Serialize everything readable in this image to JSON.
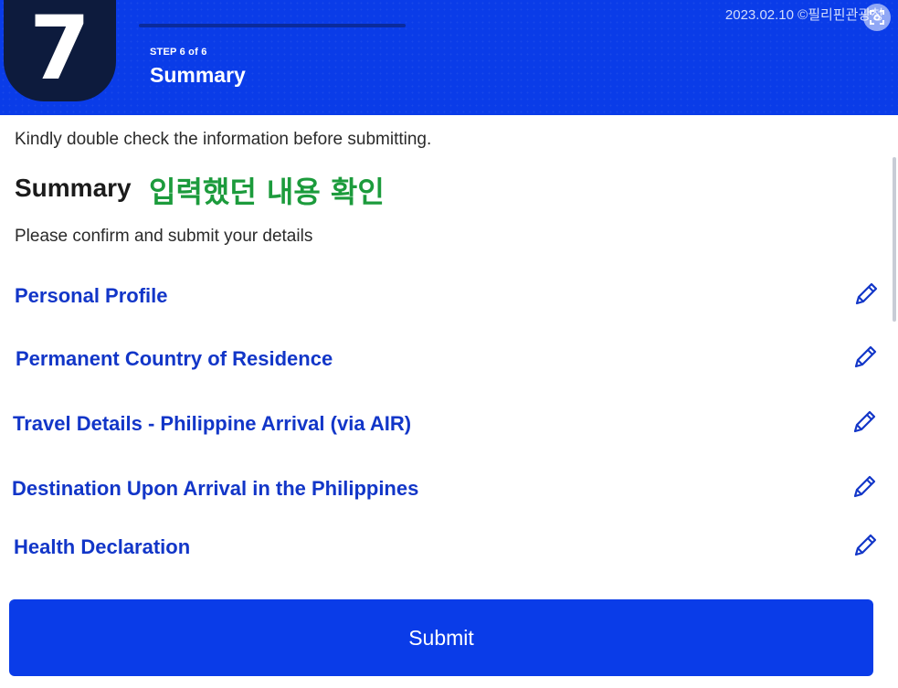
{
  "header": {
    "step_number": "7",
    "step_label": "STEP 6 of 6",
    "title": "Summary",
    "watermark": "2023.02.10 ©필리핀관광청"
  },
  "main": {
    "intro": "Kindly double check the information before submitting.",
    "summary_heading": "Summary",
    "korean_note": "입력했던 내용 확인",
    "confirm_text": "Please confirm and submit your details"
  },
  "sections": [
    {
      "label": "Personal Profile"
    },
    {
      "label": "Permanent Country of Residence"
    },
    {
      "label": "Travel Details - Philippine Arrival (via AIR)"
    },
    {
      "label": "Destination Upon Arrival in the Philippines"
    },
    {
      "label": "Health Declaration"
    }
  ],
  "submit_label": "Submit",
  "colors": {
    "primary": "#0a3ce8",
    "badge": "#0d1b3d",
    "section_text": "#1236c8",
    "annotation": "#1c9b3c"
  },
  "icons": {
    "edit": "pencil-icon",
    "scan": "scan-icon"
  }
}
